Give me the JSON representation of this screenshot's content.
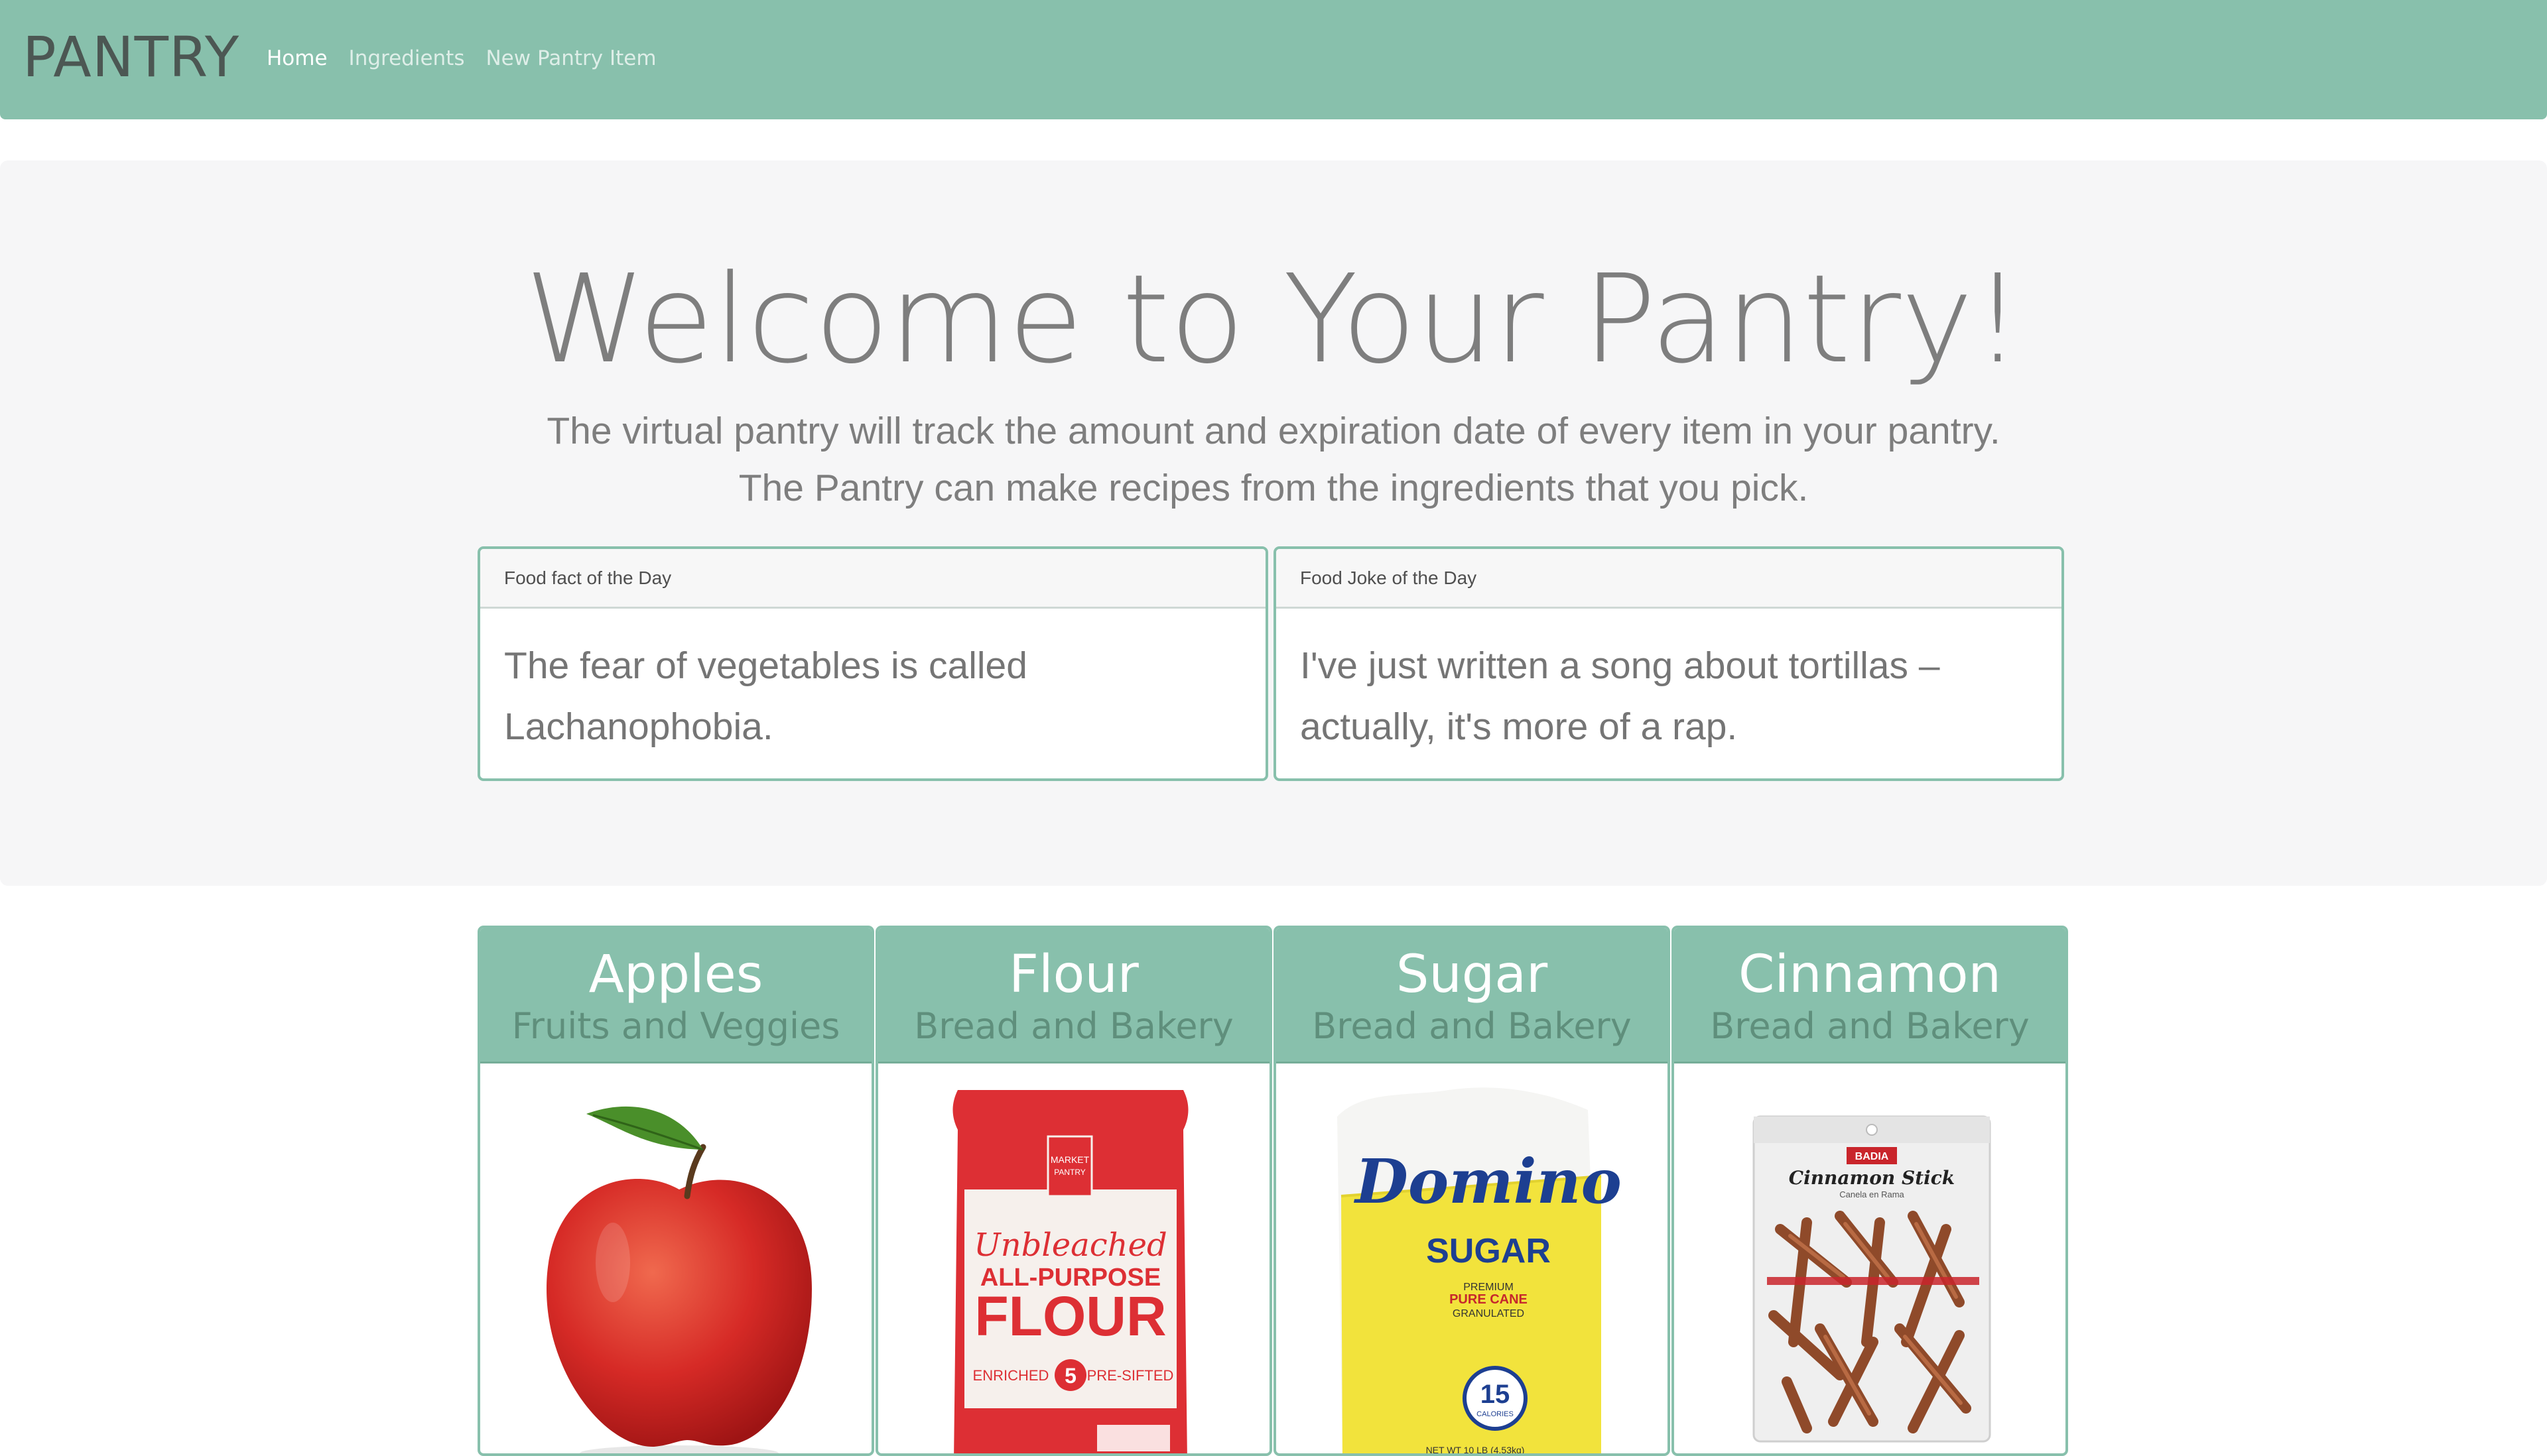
{
  "nav": {
    "brand": "PANTRY",
    "links": [
      "Home",
      "Ingredients",
      "New Pantry Item"
    ]
  },
  "hero": {
    "title": "Welcome to Your Pantry!",
    "lead_line1": "The virtual pantry will track the amount and expiration date of every item in your pantry.",
    "lead_line2": "The Pantry can make recipes from the ingredients that you pick."
  },
  "cards": [
    {
      "header": "Food fact of the Day",
      "body_line1": "The fear of vegetables is called",
      "body_line2": "Lachanophobia."
    },
    {
      "header": "Food Joke of the Day",
      "body_line1": "I've just written a song about tortillas –",
      "body_line2": "actually, it's more of a rap."
    }
  ],
  "items": [
    {
      "name": "Apples",
      "category": "Fruits and Veggies",
      "image_icon": "apple-image"
    },
    {
      "name": "Flour",
      "category": "Bread and Bakery",
      "image_icon": "flour-bag-image",
      "package": {
        "brand_line1": "MARKET",
        "brand_line2": "PANTRY",
        "script": "Unbleached",
        "type": "ALL-PURPOSE",
        "product": "FLOUR",
        "badge_left": "ENRICHED",
        "badge_num": "5",
        "badge_right": "PRE-SIFTED"
      }
    },
    {
      "name": "Sugar",
      "category": "Bread and Bakery",
      "image_icon": "sugar-bag-image",
      "package": {
        "brand": "Domino",
        "product": "SUGAR",
        "sub1": "PREMIUM",
        "sub2": "PURE CANE",
        "sub3": "GRANULATED",
        "calories": "15",
        "calories_label": "CALORIES",
        "net": "NET WT 10 LB (4.53kg)"
      }
    },
    {
      "name": "Cinnamon",
      "category": "Bread and Bakery",
      "image_icon": "cinnamon-bag-image",
      "package": {
        "brand": "BADIA",
        "product": "Cinnamon Stick",
        "sub": "Canela en Rama"
      }
    }
  ],
  "colors": {
    "accent": "#88c0ac",
    "jumbotron": "#f6f6f7",
    "text_muted": "#7e7e7e"
  }
}
